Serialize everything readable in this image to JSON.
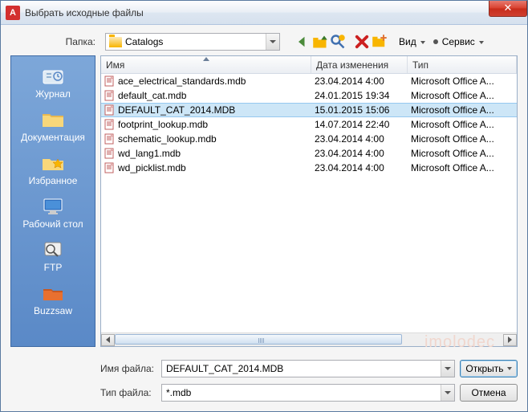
{
  "window": {
    "title": "Выбрать исходные файлы"
  },
  "path": {
    "label": "Папка:",
    "value": "Catalogs"
  },
  "toolbar": {
    "view": "Вид",
    "tools": "Сервис"
  },
  "sidebar": {
    "items": [
      {
        "label": "Журнал"
      },
      {
        "label": "Документация"
      },
      {
        "label": "Избранное"
      },
      {
        "label": "Рабочий стол"
      },
      {
        "label": "FTP"
      },
      {
        "label": "Buzzsaw"
      }
    ]
  },
  "columns": {
    "name": "Имя",
    "date": "Дата изменения",
    "type": "Тип"
  },
  "files": [
    {
      "name": "ace_electrical_standards.mdb",
      "date": "23.04.2014 4:00",
      "type": "Microsoft Office A...",
      "selected": false
    },
    {
      "name": "default_cat.mdb",
      "date": "24.01.2015 19:34",
      "type": "Microsoft Office A...",
      "selected": false
    },
    {
      "name": "DEFAULT_CAT_2014.MDB",
      "date": "15.01.2015 15:06",
      "type": "Microsoft Office A...",
      "selected": true
    },
    {
      "name": "footprint_lookup.mdb",
      "date": "14.07.2014 22:40",
      "type": "Microsoft Office A...",
      "selected": false
    },
    {
      "name": "schematic_lookup.mdb",
      "date": "23.04.2014 4:00",
      "type": "Microsoft Office A...",
      "selected": false
    },
    {
      "name": "wd_lang1.mdb",
      "date": "23.04.2014 4:00",
      "type": "Microsoft Office A...",
      "selected": false
    },
    {
      "name": "wd_picklist.mdb",
      "date": "23.04.2014 4:00",
      "type": "Microsoft Office A...",
      "selected": false
    }
  ],
  "bottom": {
    "filename_label": "Имя файла:",
    "filename_value": "DEFAULT_CAT_2014.MDB",
    "filetype_label": "Тип файла:",
    "filetype_value": "*.mdb",
    "open": "Открыть",
    "cancel": "Отмена"
  },
  "watermark": "imolodec"
}
